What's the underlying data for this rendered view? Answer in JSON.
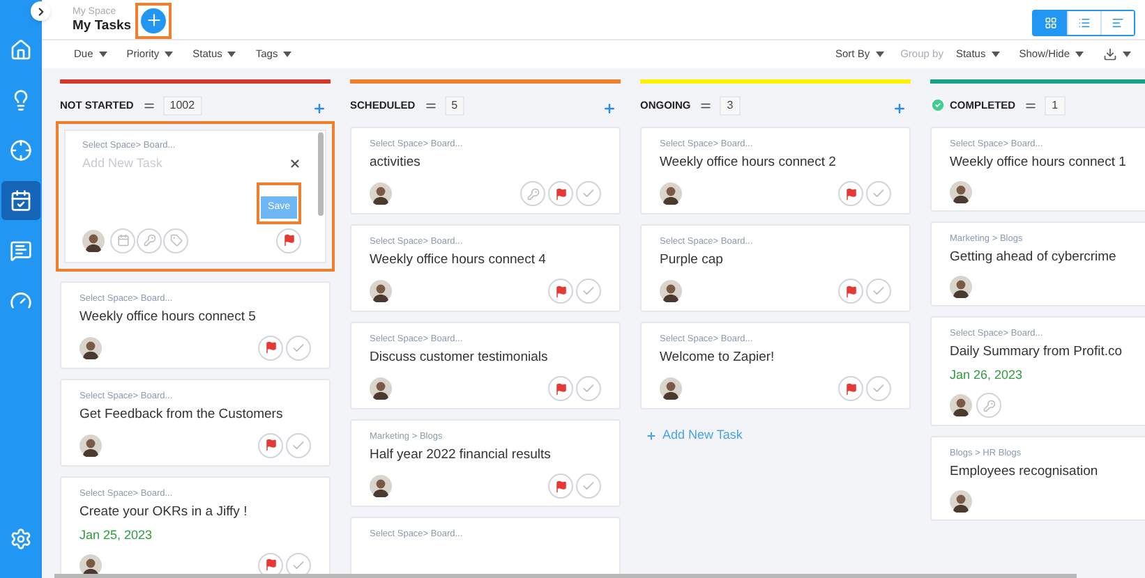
{
  "sidebar": {
    "items": [
      {
        "kind": "home",
        "selected": false
      },
      {
        "kind": "idea",
        "selected": false
      },
      {
        "kind": "target",
        "selected": false
      },
      {
        "kind": "tasks",
        "selected": true
      },
      {
        "kind": "chat",
        "selected": false
      },
      {
        "kind": "gauge",
        "selected": false
      },
      {
        "kind": "settings",
        "selected": false
      }
    ]
  },
  "header": {
    "breadcrumb": "My Space",
    "title": "My Tasks"
  },
  "views": [
    {
      "kind": "board",
      "selected": true
    },
    {
      "kind": "list",
      "selected": false
    },
    {
      "kind": "timeline",
      "selected": false
    }
  ],
  "filters": [
    "Due",
    "Priority",
    "Status",
    "Tags"
  ],
  "toolbar": {
    "sort": "Sort By",
    "group_label": "Group by",
    "group_value": "Status",
    "show_hide": "Show/Hide"
  },
  "columns": [
    {
      "title": "NOT STARTED",
      "count": "1002",
      "color": "#d0392b",
      "completed": false,
      "can_add": true,
      "new_task": {
        "path": "Select Space> Board...",
        "placeholder": "Add New Task",
        "save": "Save"
      },
      "cards": [
        {
          "path": "Select Space> Board...",
          "title": "Weekly office hours connect 5",
          "has_key": false,
          "flagged": true,
          "checkable": true
        },
        {
          "path": "Select Space> Board...",
          "title": "Get Feedback from the Customers",
          "has_key": false,
          "flagged": true,
          "checkable": true
        },
        {
          "path": "Select Space> Board...",
          "title": "Create your OKRs in a Jiffy !",
          "date": "Jan 25, 2023",
          "has_key": false,
          "flagged": true,
          "checkable": true
        }
      ]
    },
    {
      "title": "SCHEDULED",
      "count": "5",
      "color": "#f07f2d",
      "completed": false,
      "can_add": true,
      "cards": [
        {
          "path": "Select Space> Board...",
          "title": "activities",
          "has_key": true,
          "flagged": true,
          "checkable": true
        },
        {
          "path": "Select Space> Board...",
          "title": "Weekly office hours connect 4",
          "has_key": false,
          "flagged": true,
          "checkable": true
        },
        {
          "path": "Select Space> Board...",
          "title": "Discuss customer testimonials",
          "has_key": false,
          "flagged": true,
          "checkable": true
        },
        {
          "path": "Marketing > Blogs",
          "title": "Half year 2022 financial results",
          "has_key": false,
          "flagged": true,
          "checkable": true
        },
        {
          "path": "Select Space> Board..."
        }
      ]
    },
    {
      "title": "ONGOING",
      "count": "3",
      "color": "#fff200",
      "completed": false,
      "can_add": true,
      "add_task": "Add New Task",
      "cards": [
        {
          "path": "Select Space> Board...",
          "title": "Weekly office hours connect 2",
          "has_key": false,
          "flagged": true,
          "checkable": true
        },
        {
          "path": "Select Space> Board...",
          "title": "Purple cap",
          "has_key": false,
          "flagged": true,
          "checkable": true
        },
        {
          "path": "Select Space> Board...",
          "title": "Welcome to Zapier!",
          "has_key": false,
          "flagged": true,
          "checkable": true
        }
      ]
    },
    {
      "title": "COMPLETED",
      "count": "1",
      "color": "#16a085",
      "completed": true,
      "can_add": false,
      "cards": [
        {
          "path": "Select Space> Board...",
          "title": "Weekly office hours connect 1",
          "has_key": false,
          "flagged": false,
          "checkable": false
        },
        {
          "path": "Marketing > Blogs",
          "title": "Getting ahead of cybercrime",
          "has_key": false,
          "flagged": false,
          "checkable": false
        },
        {
          "path": "Select Space> Board...",
          "title": "Daily Summary from Profit.co",
          "date": "Jan 26, 2023",
          "has_key": true,
          "flagged": false,
          "checkable": false
        },
        {
          "path": "Blogs > HR Blogs",
          "title": "Employees recognisation",
          "has_key": false,
          "flagged": false,
          "checkable": false
        }
      ]
    }
  ]
}
